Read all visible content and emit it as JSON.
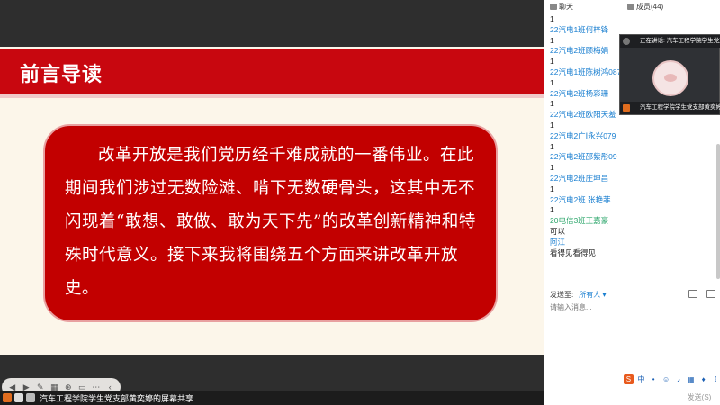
{
  "slide": {
    "title": "前言导读",
    "body": "改革开放是我们党历经千难成就的一番伟业。在此期间我们涉过无数险滩、啃下无数硬骨头，这其中无不闪现着“敢想、敢做、敢为天下先”的改革创新精神和特殊时代意义。接下来我将围绕五个方面来讲改革开放史。"
  },
  "share_bar": {
    "text": "汽车工程学院学生党支部黄奕婷的屏幕共享"
  },
  "tabs": {
    "chat": "聊天",
    "members": "成员(44)"
  },
  "video": {
    "speaking": "正在讲话: 汽车工程学院学生党支",
    "presenter": "汽车工程学院学生党支部黄奕婷"
  },
  "chat": [
    {
      "name": "",
      "text": "1"
    },
    {
      "name": "22汽电1班何梓锋",
      "text": "1"
    },
    {
      "name": "22汽电2班顾梅娟",
      "text": "1"
    },
    {
      "name": "22汽电1班陈树鸿087",
      "text": "1"
    },
    {
      "name": "22汽电2班杨彩珊",
      "text": "1"
    },
    {
      "name": "22汽电2班欧阳天羞",
      "text": "1"
    },
    {
      "name": "22汽电2广Ⅰ永兴079",
      "text": "1"
    },
    {
      "name": "22汽电2班邵紫彤09",
      "text": "1"
    },
    {
      "name": "22汽电2班庄坤昌",
      "text": "1"
    },
    {
      "name": "22汽电2班 张艳菲",
      "text": "1"
    },
    {
      "name": "20电信3班王嘉豪",
      "text": "可以",
      "green": true
    },
    {
      "name": "阿江",
      "text": "看得见看得见"
    }
  ],
  "send": {
    "label": "发送至:",
    "target": "所有人 ▾",
    "placeholder": "请输入消息...",
    "button": "发送(S)"
  },
  "ime": {
    "logo": "S",
    "mode": "中"
  }
}
